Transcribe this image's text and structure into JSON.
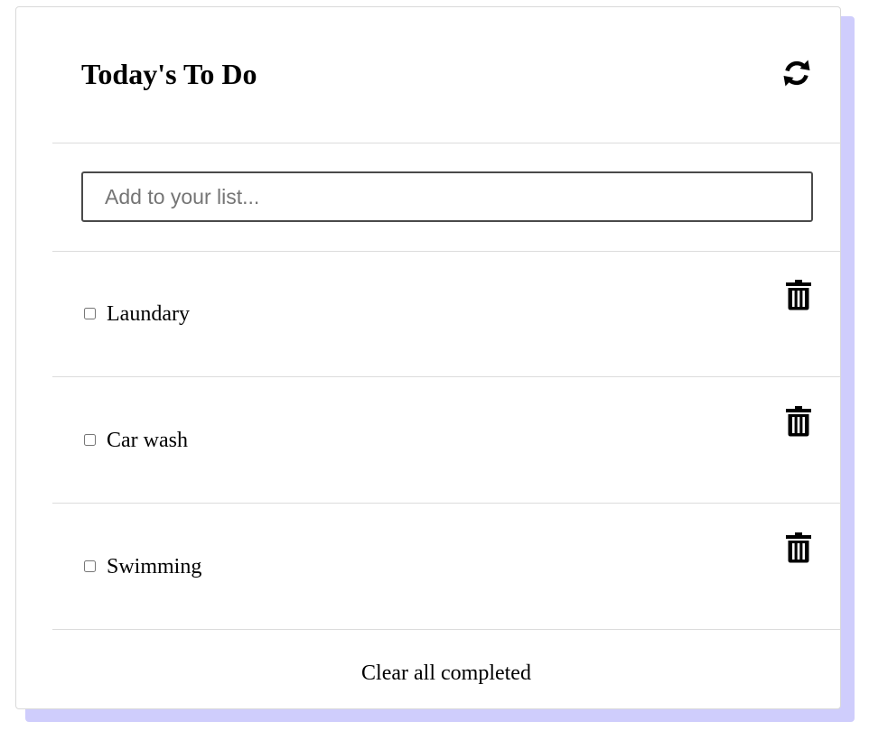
{
  "app": {
    "title": "Today's To Do",
    "refresh_icon": "refresh-icon"
  },
  "new_item": {
    "placeholder": "Add to your list...",
    "value": ""
  },
  "todos": [
    {
      "label": "Laundary",
      "completed": false,
      "delete_icon": "trash-icon"
    },
    {
      "label": "Car wash",
      "completed": false,
      "delete_icon": "trash-icon"
    },
    {
      "label": "Swimming",
      "completed": false,
      "delete_icon": "trash-icon"
    }
  ],
  "footer": {
    "clear_label": "Clear all completed"
  },
  "colors": {
    "shadow": "#cfcdfc",
    "divider": "#dcdcdc",
    "input_border": "#4a4a4a",
    "text": "#000000"
  }
}
